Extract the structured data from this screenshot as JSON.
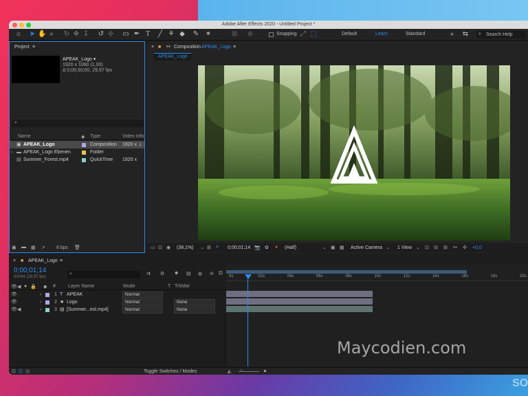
{
  "titlebar": {
    "title": "Adobe After Effects 2020 - Untitled Project *"
  },
  "toolbar": {
    "snapping": "Snapping",
    "workspaces": [
      "Default",
      "Learn",
      "Standard"
    ],
    "more": "»",
    "search_placeholder": "Search Help"
  },
  "project": {
    "title": "Project",
    "menu": "≡",
    "comp_name": "APEAK_Logo ▾",
    "comp_res": "1920 x 1080 (1,00)",
    "comp_duration": "Δ 0;00;30;00, 29,97 fps",
    "columns": [
      "Name",
      "Type",
      "Video Info"
    ],
    "items": [
      {
        "name": "APEAK_Logo",
        "type": "Composition",
        "info": "1920 x",
        "color": "#b0a8e8",
        "selected": true
      },
      {
        "name": "APEAK_Logo Ebenen",
        "type": "Folder",
        "info": "",
        "color": "#e6c84c",
        "selected": false
      },
      {
        "name": "Summer_Forest.mp4",
        "type": "QuickTime",
        "info": "1920 x",
        "color": "#8ccfc7",
        "selected": false
      }
    ],
    "bpc": "8 bpc"
  },
  "composition": {
    "panel_title": "Composition",
    "comp_link": "APEAK_Logo",
    "menu": "≡",
    "tab": "APEAK_Logo",
    "zoom": "(38,1%)",
    "timecode": "0;00;01;14",
    "resolution": "(Half)",
    "camera": "Active Camera",
    "view": "1 View",
    "exposure": "+0,0"
  },
  "timeline": {
    "tab": "APEAK_Logo",
    "menu": "≡",
    "timecode": "0;00;01;14",
    "frames": "00044 (29.97 fps)",
    "columns": {
      "layer_name": "Layer Name",
      "mode": "Mode",
      "t": "T",
      "trkmat": "TrkMat"
    },
    "ruler": [
      "0s",
      "02s",
      "04s",
      "06s",
      "08s",
      "10s",
      "12s",
      "14s",
      "16s",
      "18s",
      "20s"
    ],
    "layers": [
      {
        "num": "1",
        "name": "APEAK",
        "mode": "Normal",
        "trkmat": "",
        "color": "#b0a8e8"
      },
      {
        "num": "2",
        "name": "Logo",
        "mode": "Normal",
        "trkmat": "None",
        "color": "#b0a8e8"
      },
      {
        "num": "3",
        "name": "[Summer...est.mp4]",
        "mode": "Normal",
        "trkmat": "None",
        "color": "#8ccfc7"
      }
    ],
    "toggle": "Toggle Switches / Modes"
  },
  "watermark": "Maycodien.com",
  "corner_mark": "SO"
}
